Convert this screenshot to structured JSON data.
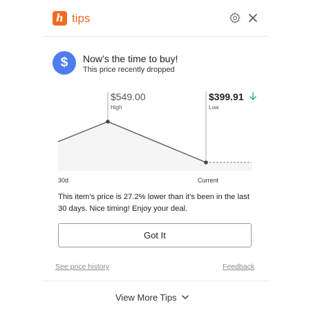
{
  "header": {
    "logo_letter": "h",
    "brand": "tips"
  },
  "alert": {
    "icon_symbol": "$",
    "title": "Now’s the time to buy!",
    "subtitle": "This price recently dropped"
  },
  "chart_data": {
    "type": "line",
    "x_labels": [
      "30d",
      "Current"
    ],
    "points": [
      {
        "label": "30d start",
        "value": 505
      },
      {
        "label": "High",
        "value": 549.0
      },
      {
        "label": "Current",
        "value": 399.91
      }
    ],
    "high": {
      "price": "$549.00",
      "label": "High"
    },
    "low": {
      "price": "$399.91",
      "label": "Low",
      "trend": "down"
    },
    "colors": {
      "line": "#555555",
      "area": "#f5f5f5",
      "marker": "#aaaaaa",
      "trend_arrow": "#1fa57a"
    }
  },
  "description": "This item’s price is 27.2% lower than it’s been in the last 30 days. Nice timing! Enjoy your deal.",
  "actions": {
    "got_it": "Got It",
    "price_history": "See price history",
    "feedback": "Feedback",
    "view_more": "View More Tips"
  },
  "colors": {
    "brand": "#f26b21",
    "alert_icon": "#4f7ded"
  }
}
